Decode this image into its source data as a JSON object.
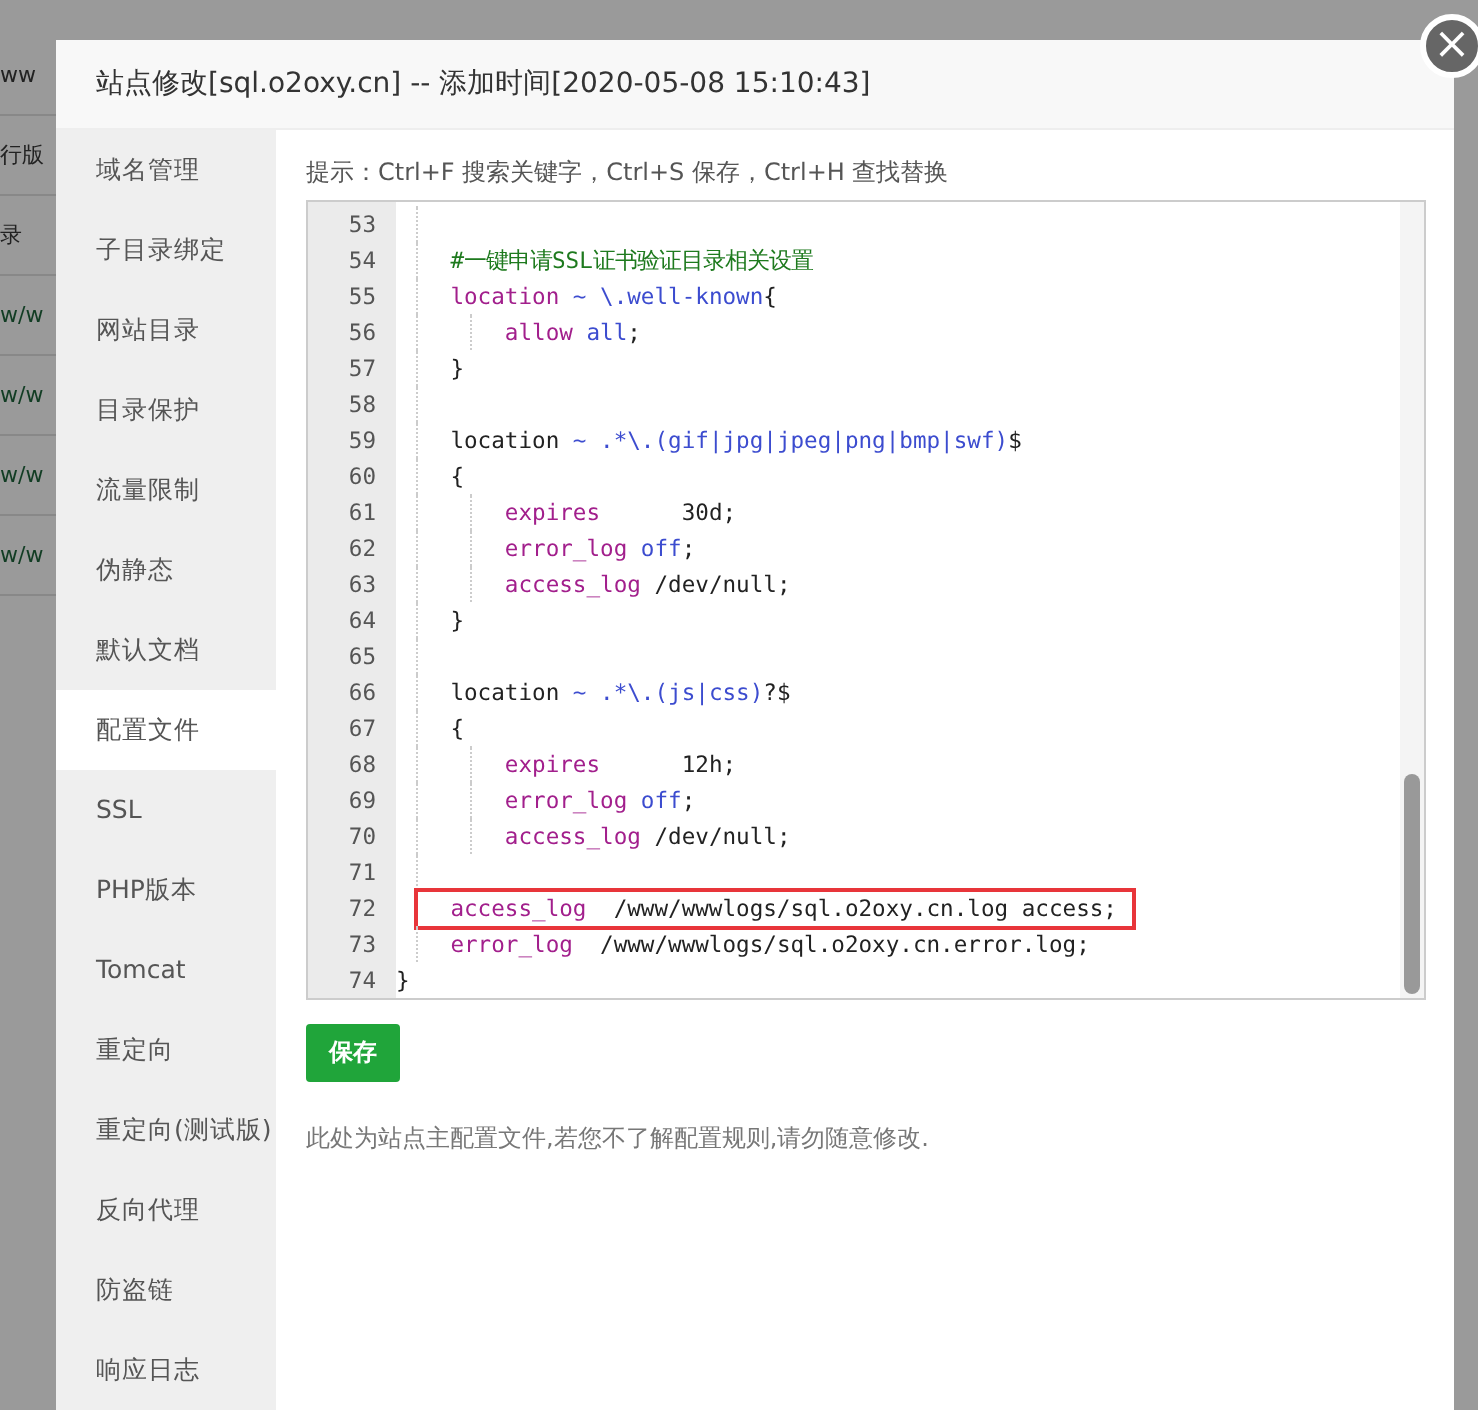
{
  "background_page": {
    "fragments": [
      "ww",
      "行版",
      "录",
      "w/w",
      "w/w",
      "w/w",
      "w/w"
    ]
  },
  "dialog": {
    "title": "站点修改[sql.o2oxy.cn] -- 添加时间[2020-05-08 15:10:43]",
    "close_icon": "×"
  },
  "sidebar": {
    "items": [
      {
        "label": "域名管理",
        "selected": false
      },
      {
        "label": "子目录绑定",
        "selected": false
      },
      {
        "label": "网站目录",
        "selected": false
      },
      {
        "label": "目录保护",
        "selected": false
      },
      {
        "label": "流量限制",
        "selected": false
      },
      {
        "label": "伪静态",
        "selected": false
      },
      {
        "label": "默认文档",
        "selected": false
      },
      {
        "label": "配置文件",
        "selected": true
      },
      {
        "label": "SSL",
        "selected": false
      },
      {
        "label": "PHP版本",
        "selected": false
      },
      {
        "label": "Tomcat",
        "selected": false
      },
      {
        "label": "重定向",
        "selected": false
      },
      {
        "label": "重定向(测试版)",
        "selected": false
      },
      {
        "label": "反向代理",
        "selected": false
      },
      {
        "label": "防盗链",
        "selected": false
      },
      {
        "label": "响应日志",
        "selected": false
      }
    ]
  },
  "hint": "提示：Ctrl+F 搜索关键字，Ctrl+S 保存，Ctrl+H 查找替换",
  "editor": {
    "lines": [
      {
        "number": "53",
        "highlighted": false
      },
      {
        "number": "54",
        "highlighted": false,
        "tokens": [
          {
            "kind": "comment",
            "text": "    #一键申请SSL证书验证目录相关设置"
          }
        ]
      },
      {
        "number": "55",
        "highlighted": false,
        "tokens": [
          {
            "kind": "keyword",
            "text": "    location"
          },
          {
            "kind": "atom",
            "text": " ~ \\.well-known"
          },
          {
            "kind": "plain",
            "text": "{"
          }
        ]
      },
      {
        "number": "56",
        "highlighted": false,
        "tokens": [
          {
            "kind": "keyword",
            "text": "        allow"
          },
          {
            "kind": "atom",
            "text": " all"
          },
          {
            "kind": "plain",
            "text": ";"
          }
        ]
      },
      {
        "number": "57",
        "highlighted": false,
        "tokens": [
          {
            "kind": "plain",
            "text": "    }"
          }
        ]
      },
      {
        "number": "58",
        "highlighted": false
      },
      {
        "number": "59",
        "highlighted": false,
        "tokens": [
          {
            "kind": "plain",
            "text": "    location"
          },
          {
            "kind": "atom",
            "text": " ~ .*\\.(gif|jpg|jpeg|png|bmp|swf)"
          },
          {
            "kind": "plain",
            "text": "$"
          }
        ]
      },
      {
        "number": "60",
        "highlighted": false,
        "tokens": [
          {
            "kind": "plain",
            "text": "    {"
          }
        ]
      },
      {
        "number": "61",
        "highlighted": false,
        "tokens": [
          {
            "kind": "keyword",
            "text": "        expires"
          },
          {
            "kind": "plain",
            "text": "      30d;"
          }
        ]
      },
      {
        "number": "62",
        "highlighted": false,
        "tokens": [
          {
            "kind": "keyword",
            "text": "        error_log"
          },
          {
            "kind": "atom",
            "text": " off"
          },
          {
            "kind": "plain",
            "text": ";"
          }
        ]
      },
      {
        "number": "63",
        "highlighted": false,
        "tokens": [
          {
            "kind": "keyword",
            "text": "        access_log"
          },
          {
            "kind": "plain",
            "text": " /dev/null;"
          }
        ]
      },
      {
        "number": "64",
        "highlighted": false,
        "tokens": [
          {
            "kind": "plain",
            "text": "    }"
          }
        ]
      },
      {
        "number": "65",
        "highlighted": false
      },
      {
        "number": "66",
        "highlighted": false,
        "tokens": [
          {
            "kind": "plain",
            "text": "    location"
          },
          {
            "kind": "atom",
            "text": " ~ .*\\.(js|css)"
          },
          {
            "kind": "plain",
            "text": "?$"
          }
        ]
      },
      {
        "number": "67",
        "highlighted": false,
        "tokens": [
          {
            "kind": "plain",
            "text": "    {"
          }
        ]
      },
      {
        "number": "68",
        "highlighted": false,
        "tokens": [
          {
            "kind": "keyword",
            "text": "        expires"
          },
          {
            "kind": "plain",
            "text": "      12h;"
          }
        ]
      },
      {
        "number": "69",
        "highlighted": false,
        "tokens": [
          {
            "kind": "keyword",
            "text": "        error_log"
          },
          {
            "kind": "atom",
            "text": " off"
          },
          {
            "kind": "plain",
            "text": ";"
          }
        ]
      },
      {
        "number": "70",
        "highlighted": false,
        "tokens": [
          {
            "kind": "keyword",
            "text": "        access_log"
          },
          {
            "kind": "plain",
            "text": " /dev/null;"
          }
        ]
      },
      {
        "number": "71",
        "highlighted": false
      },
      {
        "number": "72",
        "highlighted": true,
        "tokens": [
          {
            "kind": "keyword",
            "text": "    access_log"
          },
          {
            "kind": "plain",
            "text": "  /www/wwwlogs/sql.o2oxy.cn.log access;"
          }
        ]
      },
      {
        "number": "73",
        "highlighted": false,
        "tokens": [
          {
            "kind": "keyword",
            "text": "    error_log"
          },
          {
            "kind": "plain",
            "text": "  /www/wwwlogs/sql.o2oxy.cn.error.log;"
          }
        ]
      },
      {
        "number": "74",
        "highlighted": false,
        "tokens": [
          {
            "kind": "plain",
            "text": "}"
          }
        ]
      }
    ]
  },
  "save_button": "保存",
  "note": "此处为站点主配置文件,若您不了解配置规则,请勿随意修改."
}
